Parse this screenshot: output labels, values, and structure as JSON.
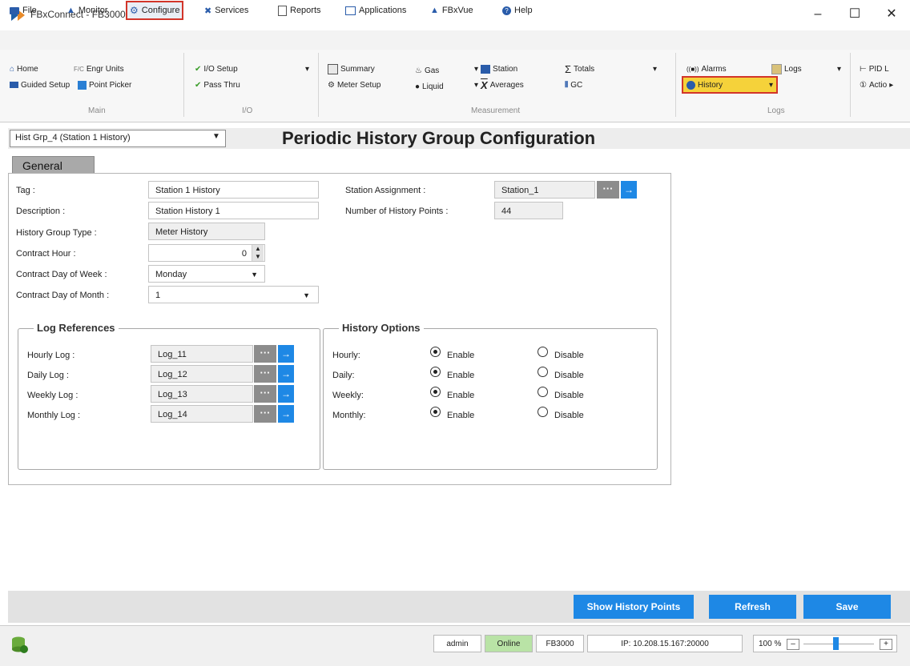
{
  "window": {
    "title": "FBxConnect - FB3000",
    "minimize": "–",
    "maximize": "☐",
    "close": "✕"
  },
  "menu": [
    "File",
    "Monitor",
    "Configure",
    "Services",
    "Reports",
    "Applications",
    "FBxVue",
    "Help"
  ],
  "ribbon": {
    "main": {
      "home": "Home",
      "engr_units": "Engr Units",
      "engr_prefix": "F/C",
      "guided_setup": "Guided Setup",
      "point_picker": "Point Picker",
      "label": "Main"
    },
    "io": {
      "io_setup": "I/O Setup",
      "pass_thru": "Pass Thru",
      "label": "I/O"
    },
    "measurement": {
      "summary": "Summary",
      "meter_setup": "Meter Setup",
      "gas": "Gas",
      "liquid": "Liquid",
      "station": "Station",
      "averages": "Averages",
      "totals": "Totals",
      "gc": "GC",
      "label": "Measurement"
    },
    "logs": {
      "alarms": "Alarms",
      "logs": "Logs",
      "history": "History",
      "label": "Logs"
    },
    "extra": {
      "pid": "PID L",
      "actions": "Actio"
    }
  },
  "selector": {
    "value": "Hist Grp_4 (Station 1 History)"
  },
  "page_title": "Periodic History Group Configuration",
  "tab": "General",
  "form": {
    "tag": {
      "label": "Tag :",
      "value": "Station 1 History"
    },
    "description": {
      "label": "Description :",
      "value": "Station History 1"
    },
    "history_group_type": {
      "label": "History Group Type :",
      "value": "Meter History"
    },
    "contract_hour": {
      "label": "Contract Hour :",
      "value": "0"
    },
    "contract_day_week": {
      "label": "Contract Day of Week :",
      "value": "Monday"
    },
    "contract_day_month": {
      "label": "Contract Day of Month :",
      "value": "1"
    },
    "station_assignment": {
      "label": "Station Assignment :",
      "value": "Station_1"
    },
    "num_history_points": {
      "label": "Number of History Points :",
      "value": "44"
    }
  },
  "log_references": {
    "title": "Log References",
    "rows": [
      {
        "label": "Hourly Log :",
        "value": "Log_11"
      },
      {
        "label": "Daily Log :",
        "value": "Log_12"
      },
      {
        "label": "Weekly Log :",
        "value": "Log_13"
      },
      {
        "label": "Monthly Log :",
        "value": "Log_14"
      }
    ]
  },
  "history_options": {
    "title": "History Options",
    "enable": "Enable",
    "disable": "Disable",
    "rows": [
      {
        "label": "Hourly:",
        "selected": "Enable"
      },
      {
        "label": "Daily:",
        "selected": "Enable"
      },
      {
        "label": "Weekly:",
        "selected": "Enable"
      },
      {
        "label": "Monthly:",
        "selected": "Enable"
      }
    ]
  },
  "buttons": {
    "show_points": "Show History Points",
    "refresh": "Refresh",
    "save": "Save"
  },
  "status": {
    "user": "admin",
    "state": "Online",
    "device": "FB3000",
    "ip": "IP: 10.208.15.167:20000",
    "zoom": "100 %"
  },
  "colors": {
    "accent": "#1e88e5",
    "highlight": "#d2352a",
    "online": "#b9e3a6"
  }
}
